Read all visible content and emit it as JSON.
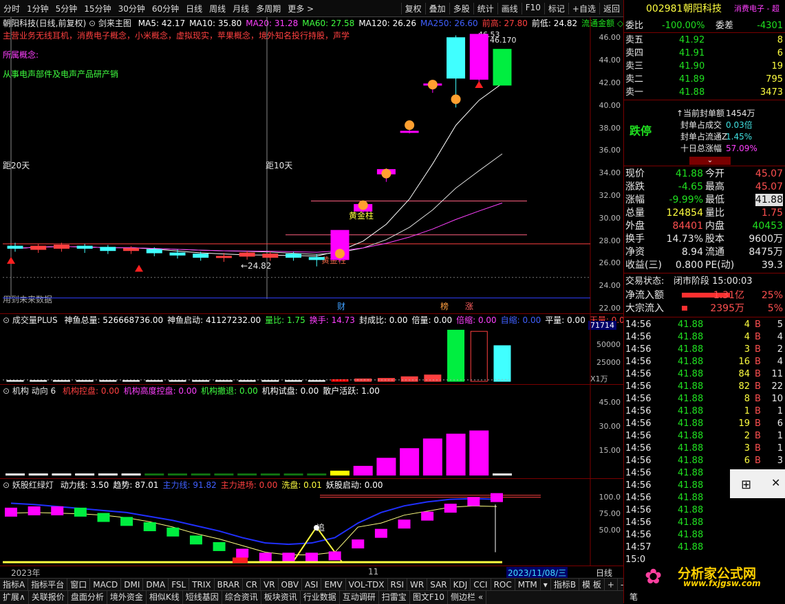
{
  "toolbar": {
    "left": [
      "分时",
      "1分钟",
      "5分钟",
      "15分钟",
      "30分钟",
      "60分钟",
      "日线",
      "周线",
      "月线",
      "多周期",
      "更多 >"
    ],
    "right": [
      "复权",
      "叠加",
      "多股",
      "统计",
      "画线",
      "F10",
      "标记",
      "+自选",
      "返回"
    ]
  },
  "main": {
    "title": "朝阳科技(日线,前复权)",
    "indicator_name": "剑来主图",
    "ma": [
      {
        "label": "MA5: 42.17",
        "color": "#ffffff"
      },
      {
        "label": "MA10: 35.80",
        "color": "#ffffff"
      },
      {
        "label": "MA20: 31.28",
        "color": "#ff40ff"
      },
      {
        "label": "MA60: 27.58",
        "color": "#40ff40"
      },
      {
        "label": "MA120: 26.26",
        "color": "#ffffff"
      },
      {
        "label": "MA250: 26.60",
        "color": "#4060ff"
      },
      {
        "label": "前高: 27.80",
        "color": "#ff4040"
      },
      {
        "label": "前低: 24.82",
        "color": "#ffffff"
      },
      {
        "label": "流通金额 ◇",
        "color": "#20e020"
      }
    ],
    "business": "主营业务无线耳机，消费电子概念，小米概念，虚拟现实，苹果概念，境外知名投行持股，声学",
    "concept_label": "所属概念:",
    "concept_text": "从事电声部件及电声产品研产销",
    "label_20": "距20天",
    "label_10": "距10天",
    "label_future": "用到未来数据",
    "label_low": "←24.82",
    "label_high": "46.53",
    "label_close": "46.170",
    "label_huangjin1": "黄金柱",
    "label_huangjin2": "黄金柱",
    "label_cai": "财",
    "label_bang": "榜",
    "label_zhang": "涨",
    "yticks": [
      "46.00",
      "44.00",
      "42.00",
      "40.00",
      "38.00",
      "36.00",
      "34.00",
      "32.00",
      "30.00",
      "28.00",
      "26.00",
      "24.00",
      "22.00"
    ]
  },
  "vol": {
    "title": "成交量PLUS",
    "items": [
      {
        "label": "神鱼总量: 526668736.00",
        "color": "#ffffff"
      },
      {
        "label": "神鱼启动: 41127232.00",
        "color": "#ffffff"
      },
      {
        "label": "量比: 1.75",
        "color": "#40ff40"
      },
      {
        "label": "换手: 14.73",
        "color": "#ff40ff"
      },
      {
        "label": "封成比: 0.00",
        "color": "#ffffff"
      },
      {
        "label": "倍量: 0.00",
        "color": "#ffffff"
      },
      {
        "label": "倍缩: 0.00",
        "color": "#ff40ff"
      },
      {
        "label": "自缩: 0.00",
        "color": "#4060ff"
      },
      {
        "label": "平量: 0.00",
        "color": "#ffffff"
      },
      {
        "label": "天量: 0.00",
        "color": "#ff4040"
      }
    ],
    "yticks": [
      "50000",
      "25000"
    ],
    "topval": "71714",
    "unit": "X1万"
  },
  "jigou": {
    "title": "机构 动向 6",
    "items": [
      {
        "label": "机构控盘: 0.00",
        "color": "#ff4040"
      },
      {
        "label": "机构高度控盘: 0.00",
        "color": "#ff40ff"
      },
      {
        "label": "机构撤退: 0.00",
        "color": "#40ff40"
      },
      {
        "label": "机构试盘: 0.00",
        "color": "#ffffff"
      },
      {
        "label": "散户活跃: 1.00",
        "color": "#ffffff"
      }
    ],
    "yticks": [
      "45.00",
      "30.00",
      "15.00"
    ],
    "values": [
      0.5,
      0.5,
      0.5,
      0.5,
      0.5,
      0.5,
      0.5,
      0.5,
      0.5,
      0.5,
      0.5,
      0.5,
      0.5,
      0.5,
      3,
      6,
      11,
      17,
      23,
      26,
      28,
      0.5
    ]
  },
  "yao": {
    "title": "妖股红绿灯",
    "items": [
      {
        "label": "动力线: 3.50",
        "color": "#ffffff"
      },
      {
        "label": "趋势: 87.01",
        "color": "#ffffff"
      },
      {
        "label": "主力线: 91.82",
        "color": "#4060ff"
      },
      {
        "label": "主力进场: 0.00",
        "color": "#ff4040"
      },
      {
        "label": "洗盘: 0.01",
        "color": "#ffff40"
      },
      {
        "label": "妖股启动: 0.00",
        "color": "#ffffff"
      }
    ],
    "yticks": [
      "100.0",
      "75.00",
      "50.00"
    ],
    "label_zhui": "追"
  },
  "timeaxis": {
    "start": "2023年",
    "mid": "11",
    "date": "2023/11/08/三",
    "mode": "日线"
  },
  "bottom1": [
    "指标A",
    "指标平台",
    "窗口",
    "MACD",
    "DMI",
    "DMA",
    "FSL",
    "TRIX",
    "BRAR",
    "CR",
    "VR",
    "OBV",
    "ASI",
    "EMV",
    "VOL-TDX",
    "RSI",
    "WR",
    "SAR",
    "KDJ",
    "CCI",
    "ROC",
    "MTM",
    "▾",
    "指标B",
    "模 板",
    "+",
    "-"
  ],
  "bottom2": [
    "扩展∧",
    "关联报价",
    "盘面分析",
    "境外资金",
    "相似K线",
    "短线基因",
    "综合资讯",
    "板块资讯",
    "行业数据",
    "互动调研",
    "扫雷宝",
    "图文F10",
    "侧边栏 «"
  ],
  "quote": {
    "code": "002981",
    "name": "朝阳科技",
    "tag": "消费电子 - 超",
    "weibi_label": "委比",
    "weibi": "-100.00%",
    "weicha_label": "委差",
    "weicha": "-4301",
    "asks": [
      {
        "label": "卖五",
        "price": "41.92",
        "vol": "8"
      },
      {
        "label": "卖四",
        "price": "41.91",
        "vol": "6"
      },
      {
        "label": "卖三",
        "price": "41.90",
        "vol": "19"
      },
      {
        "label": "卖二",
        "price": "41.89",
        "vol": "795"
      },
      {
        "label": "卖一",
        "price": "41.88",
        "vol": "3473"
      }
    ],
    "dieting": "跌停",
    "feng": [
      {
        "label": "当前封单额",
        "val": "1454万",
        "color": "#e8e8e8"
      },
      {
        "label": "封单占成交",
        "val": "0.03倍",
        "color": "#40e0e0"
      },
      {
        "label": "封单占流通Z",
        "val": "1.45%",
        "color": "#40e0e0"
      },
      {
        "label": "十日总涨幅",
        "val": "57.09%",
        "color": "#ff40ff"
      }
    ],
    "stats": [
      {
        "l1": "现价",
        "v1": "41.88",
        "c1": "#20e020",
        "l2": "今开",
        "v2": "45.07",
        "c2": "#ff5050"
      },
      {
        "l1": "涨跌",
        "v1": "-4.65",
        "c1": "#20e020",
        "l2": "最高",
        "v2": "45.07",
        "c2": "#ff5050"
      },
      {
        "l1": "涨幅",
        "v1": "-9.99%",
        "c1": "#20e020",
        "l2": "最低",
        "v2": "41.88",
        "c2": "#20e020"
      },
      {
        "l1": "总量",
        "v1": "124854",
        "c1": "#ffff40",
        "l2": "量比",
        "v2": "1.75",
        "c2": "#ff5050"
      },
      {
        "l1": "外盘",
        "v1": "84401",
        "c1": "#ff5050",
        "l2": "内盘",
        "v2": "40453",
        "c2": "#20e020"
      },
      {
        "l1": "换手",
        "v1": "14.73%",
        "c1": "#e8e8e8",
        "l2": "股本",
        "v2": "9600万",
        "c2": "#e8e8e8"
      },
      {
        "l1": "净资",
        "v1": "8.94",
        "c1": "#e8e8e8",
        "l2": "流通",
        "v2": "8475万",
        "c2": "#e8e8e8"
      },
      {
        "l1": "收益(三)",
        "v1": "0.800",
        "c1": "#e8e8e8",
        "l2": "PE(动)",
        "v2": "39.3",
        "c2": "#e8e8e8"
      }
    ],
    "trade_state_label": "交易状态:",
    "trade_state": "闭市阶段 15:00:03",
    "inflow": [
      {
        "label": "净流入额",
        "val": "1.31亿",
        "pct": "25%"
      },
      {
        "label": "大宗流入",
        "val": "2395万",
        "pct": "5%"
      }
    ],
    "ticks": [
      {
        "t": "14:56",
        "p": "41.88",
        "v": "4",
        "b": "B",
        "n": "5"
      },
      {
        "t": "14:56",
        "p": "41.88",
        "v": "4",
        "b": "B",
        "n": "4"
      },
      {
        "t": "14:56",
        "p": "41.88",
        "v": "3",
        "b": "B",
        "n": "2"
      },
      {
        "t": "14:56",
        "p": "41.88",
        "v": "16",
        "b": "B",
        "n": "4"
      },
      {
        "t": "14:56",
        "p": "41.88",
        "v": "84",
        "b": "B",
        "n": "11"
      },
      {
        "t": "14:56",
        "p": "41.88",
        "v": "82",
        "b": "B",
        "n": "22"
      },
      {
        "t": "14:56",
        "p": "41.88",
        "v": "8",
        "b": "B",
        "n": "10"
      },
      {
        "t": "14:56",
        "p": "41.88",
        "v": "1",
        "b": "B",
        "n": "1"
      },
      {
        "t": "14:56",
        "p": "41.88",
        "v": "19",
        "b": "B",
        "n": "6"
      },
      {
        "t": "14:56",
        "p": "41.88",
        "v": "2",
        "b": "B",
        "n": "1"
      },
      {
        "t": "14:56",
        "p": "41.88",
        "v": "3",
        "b": "B",
        "n": "1"
      },
      {
        "t": "14:56",
        "p": "41.88",
        "v": "6",
        "b": "B",
        "n": "3"
      },
      {
        "t": "14:56",
        "p": "41.88",
        "v": "",
        "b": "",
        "n": ""
      },
      {
        "t": "14:56",
        "p": "41.88",
        "v": "",
        "b": "",
        "n": ""
      },
      {
        "t": "14:56",
        "p": "41.88",
        "v": "",
        "b": "",
        "n": ""
      },
      {
        "t": "14:56",
        "p": "41.88",
        "v": "",
        "b": "",
        "n": ""
      },
      {
        "t": "14:56",
        "p": "41.88",
        "v": "",
        "b": "",
        "n": ""
      },
      {
        "t": "14:56",
        "p": "41.88",
        "v": "",
        "b": "",
        "n": ""
      },
      {
        "t": "14:57",
        "p": "41.88",
        "v": "",
        "b": "",
        "n": ""
      },
      {
        "t": "15:0",
        "p": "",
        "v": "",
        "b": "",
        "n": ""
      }
    ],
    "win_icon": "windows-icon",
    "watermark": "分析家公式网",
    "watermark_url": "www.fxjgsw.com",
    "bottom_label": "笔"
  },
  "chart_data": {
    "type": "candlestick",
    "title": "朝阳科技(日线,前复权)",
    "ylim": [
      22,
      47
    ],
    "candles": [
      {
        "o": 27.6,
        "c": 27.4,
        "h": 27.9,
        "l": 27.1
      },
      {
        "o": 27.3,
        "c": 27.6,
        "h": 27.8,
        "l": 27.0
      },
      {
        "o": 27.4,
        "c": 27.7,
        "h": 27.9,
        "l": 27.1
      },
      {
        "o": 27.6,
        "c": 27.4,
        "h": 27.8,
        "l": 27.0
      },
      {
        "o": 27.5,
        "c": 27.2,
        "h": 27.7,
        "l": 26.9
      },
      {
        "o": 27.2,
        "c": 27.4,
        "h": 27.6,
        "l": 26.9
      },
      {
        "o": 27.3,
        "c": 27.0,
        "h": 27.5,
        "l": 26.7
      },
      {
        "o": 27.0,
        "c": 26.8,
        "h": 27.3,
        "l": 26.5
      },
      {
        "o": 26.9,
        "c": 26.6,
        "h": 27.1,
        "l": 26.3
      },
      {
        "o": 26.6,
        "c": 26.7,
        "h": 27.0,
        "l": 26.2
      },
      {
        "o": 26.7,
        "c": 27.0,
        "h": 27.2,
        "l": 26.4
      },
      {
        "o": 26.6,
        "c": 26.9,
        "h": 27.1,
        "l": 26.3
      },
      {
        "o": 26.9,
        "c": 26.6,
        "h": 27.1,
        "l": 26.3
      },
      {
        "o": 26.6,
        "c": 26.4,
        "h": 26.9,
        "l": 25.8
      },
      {
        "o": 26.4,
        "c": 29.0,
        "h": 29.0,
        "l": 26.2
      },
      {
        "o": 30.7,
        "c": 31.3,
        "h": 31.6,
        "l": 30.5
      },
      {
        "o": 34.0,
        "c": 34.4,
        "h": 34.5,
        "l": 33.3
      },
      {
        "o": 37.8,
        "c": 37.8,
        "h": 38.3,
        "l": 37.6
      },
      {
        "o": 42.0,
        "c": 42.0,
        "h": 42.1,
        "l": 41.2
      },
      {
        "o": 42.5,
        "c": 46.1,
        "h": 46.3,
        "l": 39.9
      },
      {
        "o": 46.4,
        "c": 42.4,
        "h": 46.53,
        "l": 42.2
      },
      {
        "o": 45.07,
        "c": 41.88,
        "h": 45.07,
        "l": 41.88
      }
    ],
    "volumes": [
      2,
      2,
      2,
      2,
      2,
      2,
      2,
      1,
      2,
      1,
      2,
      2,
      1,
      2,
      4,
      5,
      6,
      9,
      14,
      71714,
      70000,
      50000
    ]
  }
}
